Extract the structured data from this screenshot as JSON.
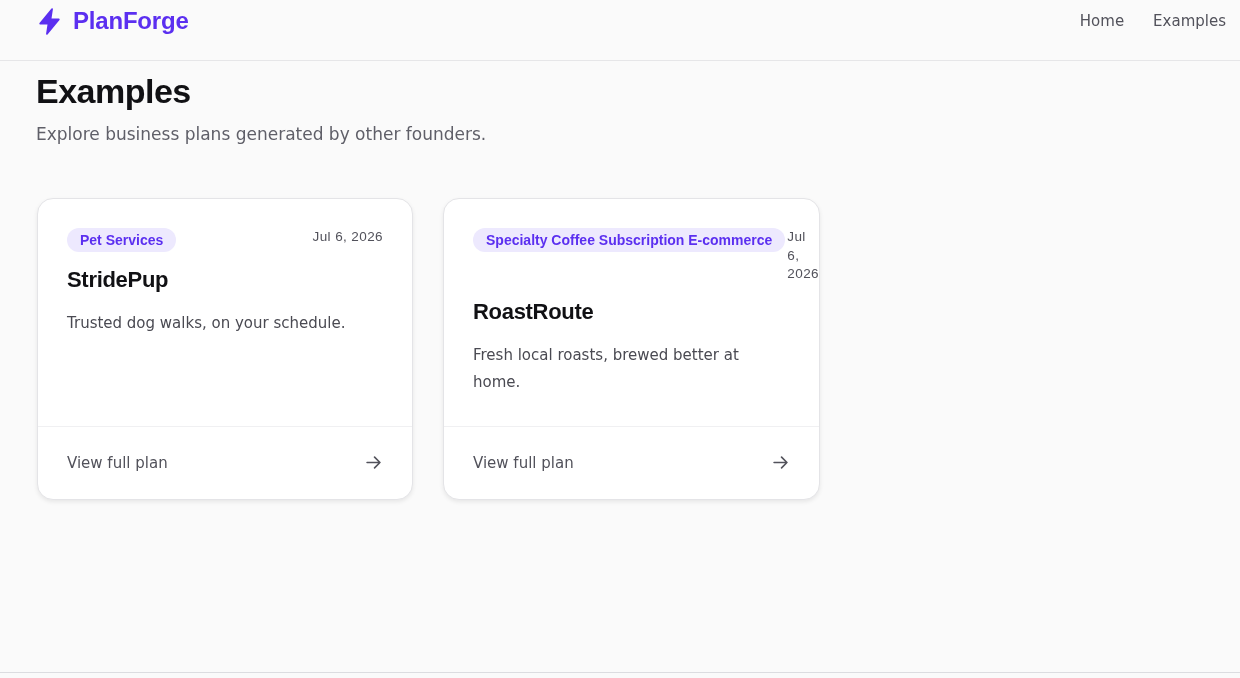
{
  "header": {
    "brand": "PlanForge",
    "nav": [
      {
        "label": "Home"
      },
      {
        "label": "Examples"
      }
    ]
  },
  "page": {
    "title": "Examples",
    "subtitle": "Explore business plans generated by other founders."
  },
  "cards": [
    {
      "category": "Pet Services",
      "date": "Jul 6, 2026",
      "name": "StridePup",
      "tagline": "Trusted dog walks, on your schedule.",
      "link": "View full plan"
    },
    {
      "category": "Specialty Coffee Subscription E-commerce",
      "date": "Jul 6, 2026",
      "name": "RoastRoute",
      "tagline": "Fresh local roasts, brewed better at home.",
      "link": "View full plan"
    }
  ]
}
